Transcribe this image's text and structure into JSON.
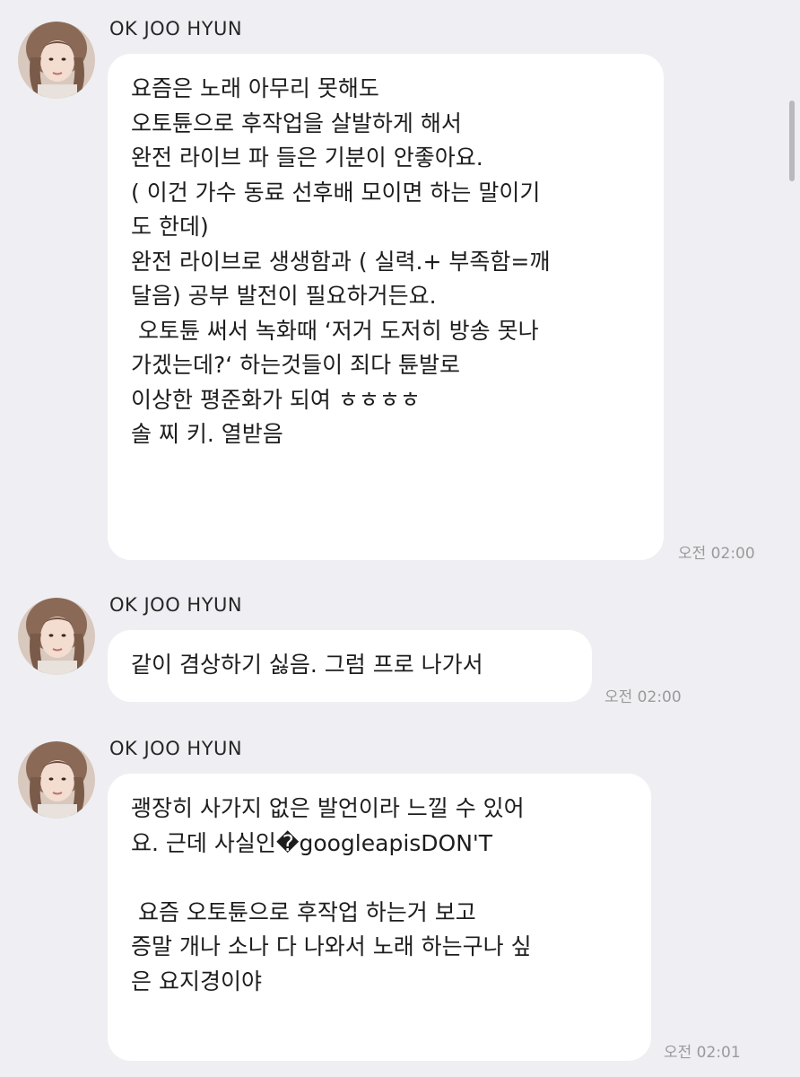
{
  "messages": [
    {
      "sender": "OK JOO HYUN",
      "avatar_icon": "profile-photo-avatar",
      "lines": [
        "요즘은 노래 아무리 못해도",
        "오토튠으로 후작업을 살발하게 해서",
        "완전 라이브 파 들은 기분이 안좋아요.",
        "( 이건 가수 동료 선후배 모이면 하는 말이기",
        "도 한데)",
        "완전 라이브로 생생함과 ( 실력.+ 부족함=깨",
        "달음) 공부 발전이 필요하거든요.",
        " 오토튠 써서 녹화때 ‘저거 도저히 방송 못나",
        "가겠는데?‘ 하는것들이 죄다 튠발로",
        "이상한 평준화가 되여 ㅎㅎㅎㅎ",
        "솔 찌 키. 열받음"
      ],
      "time": "오전 02:00"
    },
    {
      "sender": "OK JOO HYUN",
      "avatar_icon": "profile-photo-avatar",
      "lines": [
        "같이 겸상하기 싫음. 그럼 프로 나가서"
      ],
      "time": "오전 02:00"
    },
    {
      "sender": "OK JOO HYUN",
      "avatar_icon": "profile-photo-avatar",
      "lines": [
        "괭장히 사가지 없은 발언이라 느낄 수 있어",
        "요. 근데 사실인�googleapisDON'T",
        "",
        " 요즘 오토튠으로 후작업 하는거 보고",
        "증말 개나 소나 다 나와서 노래 하는구나 싶",
        "은 요지경이야"
      ],
      "time": "오전 02:01"
    }
  ],
  "colors": {
    "background": "#efeff3",
    "bubble": "#ffffff",
    "timestamp": "#9a9a9a"
  }
}
